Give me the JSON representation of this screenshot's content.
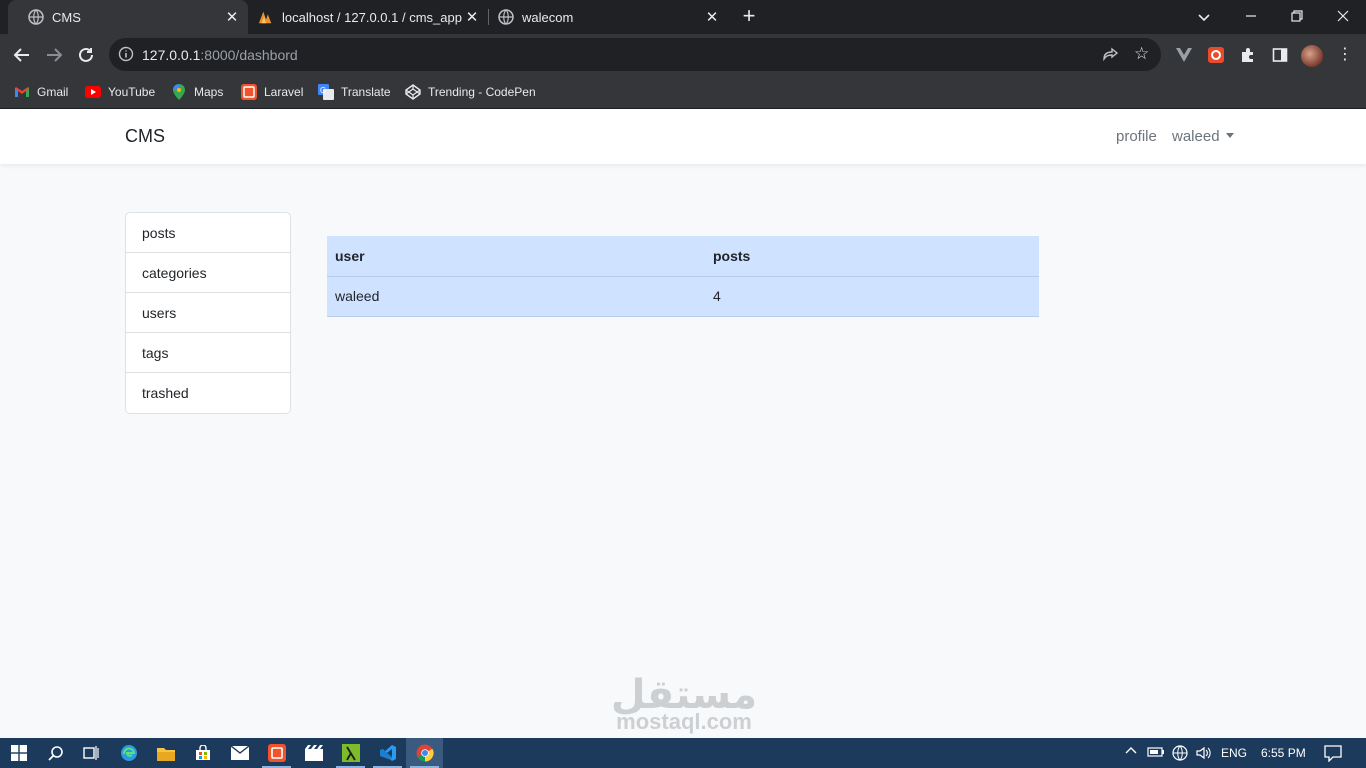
{
  "browser": {
    "tabs": [
      {
        "title": "CMS",
        "favicon": "globe-icon",
        "active": true
      },
      {
        "title": "localhost / 127.0.0.1 / cms_app / ",
        "favicon": "phpmyadmin-icon",
        "active": false
      },
      {
        "title": "walecom",
        "favicon": "globe-icon",
        "active": false
      }
    ],
    "new_tab": "+",
    "url_host": "127.0.0.1",
    "url_path": ":8000/dashbord"
  },
  "bookmarks": [
    {
      "label": "Gmail",
      "icon": "gmail-icon"
    },
    {
      "label": "YouTube",
      "icon": "youtube-icon"
    },
    {
      "label": "Maps",
      "icon": "maps-icon"
    },
    {
      "label": "Laravel",
      "icon": "laravel-icon"
    },
    {
      "label": "Translate",
      "icon": "translate-icon"
    },
    {
      "label": "Trending - CodePen",
      "icon": "codepen-icon"
    }
  ],
  "app": {
    "brand": "CMS",
    "nav": {
      "profile": "profile",
      "user": "waleed"
    },
    "sidebar": [
      {
        "label": "posts"
      },
      {
        "label": "categories"
      },
      {
        "label": "users"
      },
      {
        "label": "tags"
      },
      {
        "label": "trashed"
      }
    ],
    "table": {
      "headers": [
        "user",
        "posts"
      ],
      "rows": [
        [
          "waleed",
          "4"
        ]
      ]
    }
  },
  "watermark": {
    "arabic": "مستقل",
    "latin": "mostaql.com"
  },
  "taskbar": {
    "lang": "ENG",
    "time": "6:55 PM"
  },
  "colors": {
    "table_bg": "#cfe2ff",
    "chrome_dark": "#202124",
    "taskbar": "#1c3a5c"
  }
}
